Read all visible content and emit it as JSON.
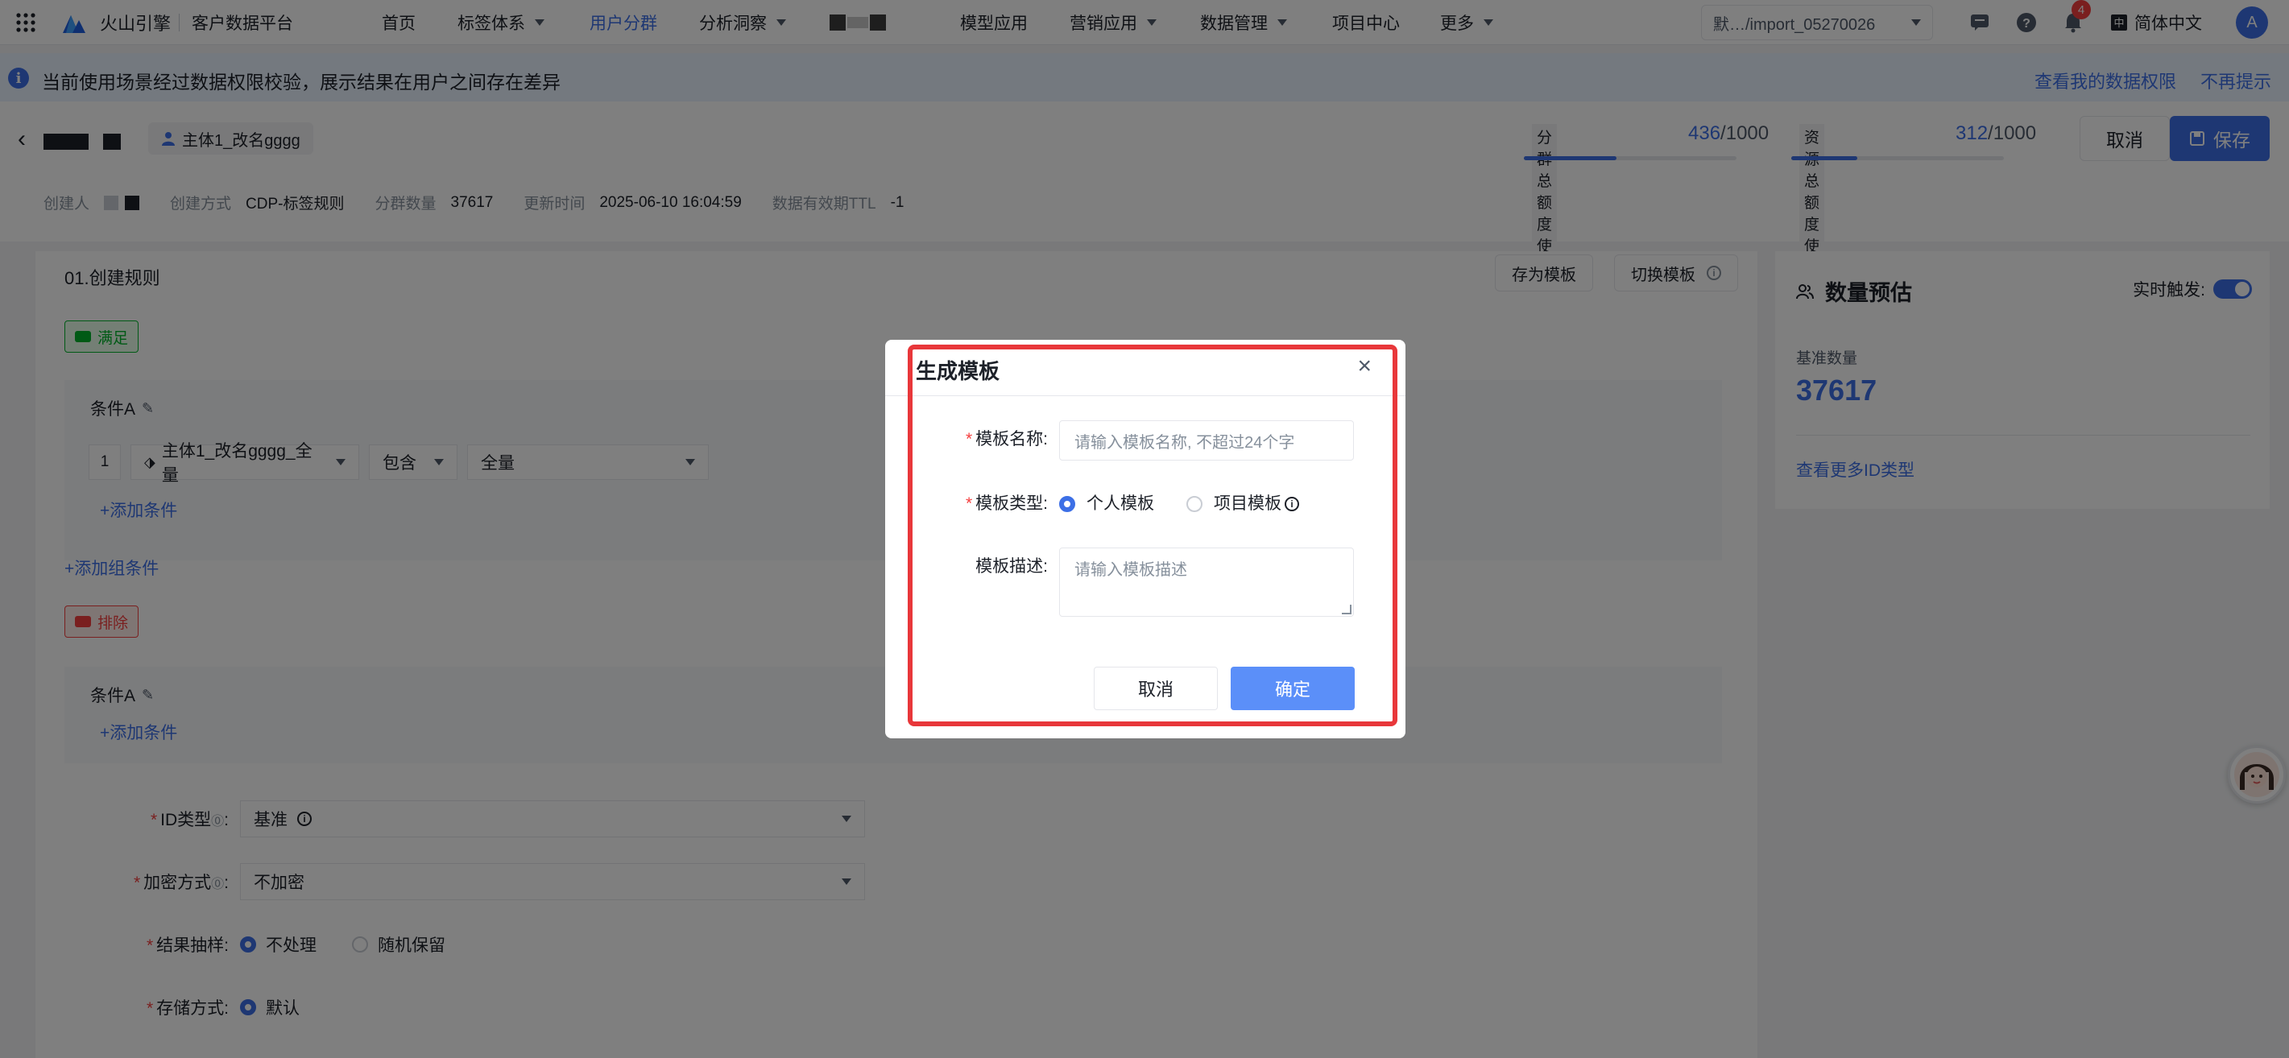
{
  "topnav": {
    "brand": "火山引擎",
    "product": "客户数据平台",
    "items": [
      {
        "label": "首页",
        "caret": false
      },
      {
        "label": "标签体系",
        "caret": true
      },
      {
        "label": "用户分群",
        "caret": false,
        "active": true
      },
      {
        "label": "分析洞察",
        "caret": true
      },
      {
        "label": "模型应用",
        "caret": false
      },
      {
        "label": "营销应用",
        "caret": true
      },
      {
        "label": "数据管理",
        "caret": true
      },
      {
        "label": "项目中心",
        "caret": false
      },
      {
        "label": "更多",
        "caret": true
      }
    ],
    "workspace": "默…/import_05270026",
    "notification_count": "4",
    "language": "简体中文",
    "avatar_letter": "A"
  },
  "notice": {
    "text": "当前使用场景经过数据权限校验，展示结果在用户之间存在差异",
    "link_view": "查看我的数据权限",
    "link_dismiss": "不再提示"
  },
  "header": {
    "subject_tag": "主体1_改名gggg",
    "quota_segment_label": "分群总额度使用",
    "quota_segment_used": "436",
    "quota_segment_total": "/1000",
    "quota_segment_fraction": 0.436,
    "quota_resource_label": "资源总额度使用",
    "quota_resource_used": "312",
    "quota_resource_total": "/1000",
    "quota_resource_fraction": 0.312,
    "cancel": "取消",
    "save": "保存",
    "meta": {
      "creator_label": "创建人",
      "method_label": "创建方式",
      "method_value": "CDP-标签规则",
      "count_label": "分群数量",
      "count_value": "37617",
      "updated_label": "更新时间",
      "updated_value": "2025-06-10 16:04:59",
      "ttl_label": "数据有效期TTL",
      "ttl_value": "-1"
    }
  },
  "rules": {
    "section_title": "01.创建规则",
    "save_as_template": "存为模板",
    "switch_template": "切换模板",
    "satisfy_tag": "满足",
    "exclude_tag": "排除",
    "condition_a": "条件A",
    "row_number": "1",
    "field_select": "主体1_改名gggg_全量",
    "operator_select": "包含",
    "value_select": "全量",
    "add_condition": "+添加条件",
    "add_group": "+添加组条件"
  },
  "form": {
    "id_type_label": "ID类型",
    "id_type_value": "基准",
    "encrypt_label": "加密方式",
    "encrypt_value": "不加密",
    "sampling_label": "结果抽样:",
    "sampling_opt1": "不处理",
    "sampling_opt2": "随机保留",
    "storage_label": "存储方式:",
    "storage_opt1": "默认"
  },
  "estimate": {
    "title": "数量预估",
    "realtime_label": "实时触发:",
    "base_label": "基准数量",
    "base_value": "37617",
    "more_link": "查看更多ID类型"
  },
  "modal": {
    "title": "生成模板",
    "name_label": "模板名称:",
    "name_placeholder": "请输入模板名称, 不超过24个字",
    "type_label": "模板类型:",
    "type_personal": "个人模板",
    "type_project": "项目模板",
    "desc_label": "模板描述:",
    "desc_placeholder": "请输入模板描述",
    "cancel": "取消",
    "confirm": "确定"
  }
}
